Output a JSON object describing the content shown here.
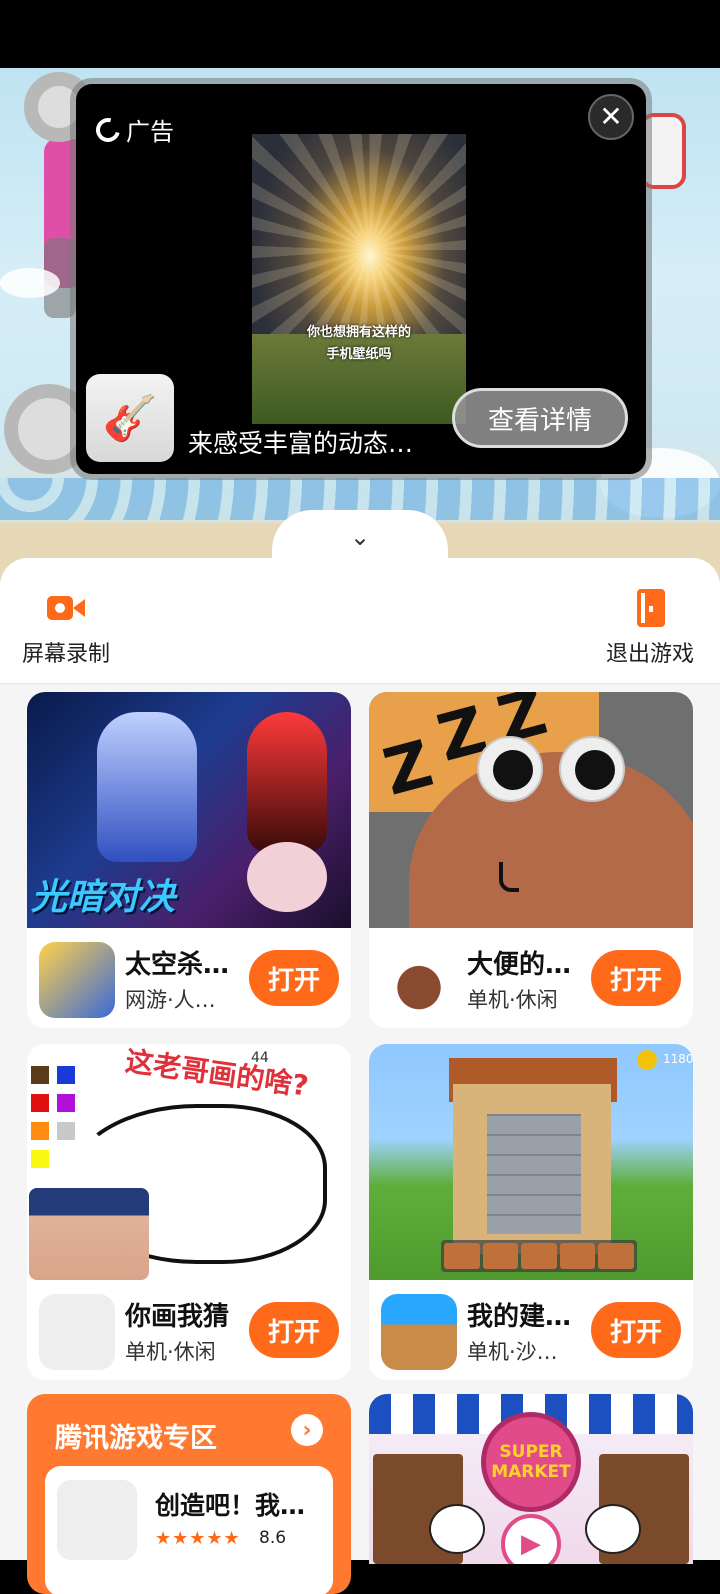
{
  "ad": {
    "label": "广告",
    "close_glyph": "✕",
    "video_caption_line1": "你也想拥有这样的",
    "video_caption_line2": "手机壁纸吗",
    "title": "来感受丰富的动态…",
    "detail_button": "查看详情",
    "app_icon": "guitar-icon"
  },
  "collapse_glyph": "⌄",
  "toolbar": {
    "record_label": "屏幕录制",
    "exit_label": "退出游戏"
  },
  "games": [
    {
      "name": "太空杀…",
      "tags": "网游·人…",
      "button": "打开",
      "thumb_logo": "光暗对决"
    },
    {
      "name": "大便的…",
      "tags": "单机·休闲",
      "button": "打开"
    },
    {
      "name": "你画我猜",
      "tags": "单机·休闲",
      "button": "打开",
      "thumb_caption": "这老哥画的啥?",
      "thumb_counter": "44"
    },
    {
      "name": "我的建…",
      "tags": "单机·沙…",
      "button": "打开",
      "thumb_coins": "1180"
    }
  ],
  "tencent_zone": {
    "title": "腾讯游戏专区",
    "arrow": "›",
    "game_name": "创造吧！我…",
    "stars": "★★★★★",
    "score": "8.6"
  },
  "promo": {
    "badge_line1": "SUPER",
    "badge_line2": "MARKET",
    "play_glyph": "▶"
  },
  "colors": {
    "accent": "#ff6a1a",
    "tencent_card": "#ff7a30"
  }
}
